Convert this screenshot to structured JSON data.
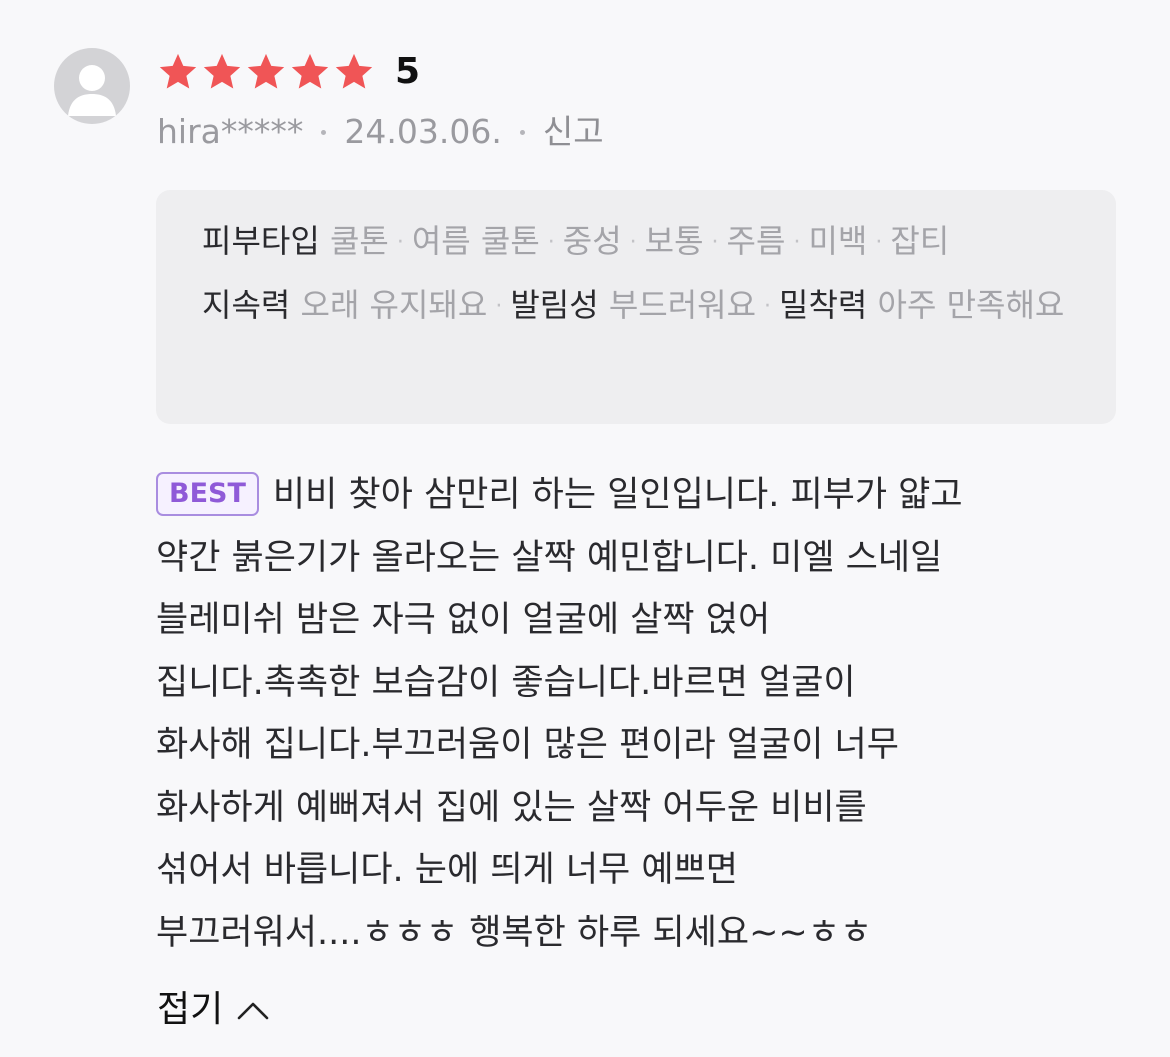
{
  "review": {
    "rating_value": "5",
    "stars_filled": 5,
    "stars_total": 5,
    "star_color": "#f05556",
    "user": "hira*****",
    "date": "24.03.06.",
    "report_label": "신고",
    "tags": {
      "skin_type_label": "피부타입",
      "skin_type_values": [
        "쿨톤",
        "여름 쿨톤",
        "중성",
        "보통",
        "주름",
        "미백",
        "잡티"
      ],
      "attributes": [
        {
          "label": "지속력",
          "value": "오래 유지돼요"
        },
        {
          "label": "발림성",
          "value": "부드러워요"
        },
        {
          "label": "밀착력",
          "value": "아주 만족해요"
        }
      ]
    },
    "badge": "BEST",
    "lines": [
      "비비 찾아 삼만리 하는 일인입니다. 피부가 얇고",
      "약간 붉은기가 올라오는 살짝 예민합니다. 미엘 스네일",
      "블레미쉬 밤은 자극 없이 얼굴에 살짝 얹어",
      "집니다.촉촉한 보습감이 좋습니다.바르면 얼굴이",
      "화사해 집니다.부끄러움이 많은 편이라 얼굴이 너무",
      "화사하게 예뻐져서 집에 있는 살짝 어두운 비비를",
      "섞어서 바릅니다. 눈에 띄게 너무 예쁘면",
      "부끄러워서....ㅎㅎㅎ 행복한 하루 되세요~~ㅎㅎ"
    ],
    "collapse_label": "접기"
  }
}
